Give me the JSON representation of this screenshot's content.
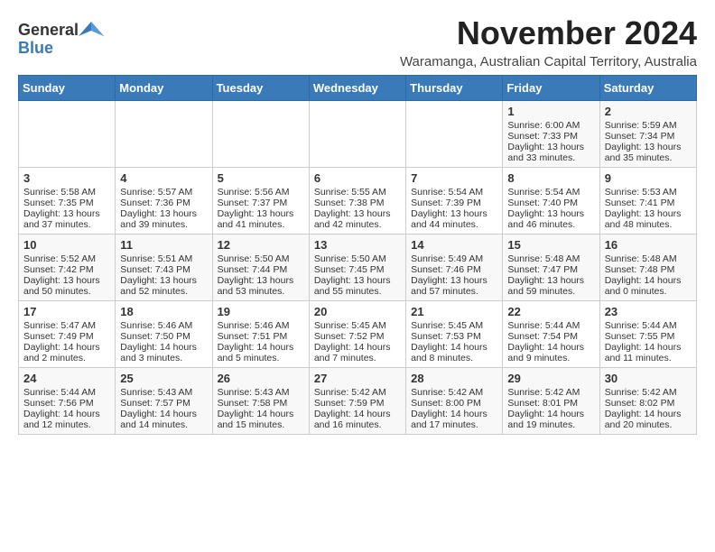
{
  "logo": {
    "general": "General",
    "blue": "Blue"
  },
  "title": "November 2024",
  "subtitle": "Waramanga, Australian Capital Territory, Australia",
  "headers": [
    "Sunday",
    "Monday",
    "Tuesday",
    "Wednesday",
    "Thursday",
    "Friday",
    "Saturday"
  ],
  "weeks": [
    [
      {
        "day": "",
        "lines": []
      },
      {
        "day": "",
        "lines": []
      },
      {
        "day": "",
        "lines": []
      },
      {
        "day": "",
        "lines": []
      },
      {
        "day": "",
        "lines": []
      },
      {
        "day": "1",
        "lines": [
          "Sunrise: 6:00 AM",
          "Sunset: 7:33 PM",
          "Daylight: 13 hours",
          "and 33 minutes."
        ]
      },
      {
        "day": "2",
        "lines": [
          "Sunrise: 5:59 AM",
          "Sunset: 7:34 PM",
          "Daylight: 13 hours",
          "and 35 minutes."
        ]
      }
    ],
    [
      {
        "day": "3",
        "lines": [
          "Sunrise: 5:58 AM",
          "Sunset: 7:35 PM",
          "Daylight: 13 hours",
          "and 37 minutes."
        ]
      },
      {
        "day": "4",
        "lines": [
          "Sunrise: 5:57 AM",
          "Sunset: 7:36 PM",
          "Daylight: 13 hours",
          "and 39 minutes."
        ]
      },
      {
        "day": "5",
        "lines": [
          "Sunrise: 5:56 AM",
          "Sunset: 7:37 PM",
          "Daylight: 13 hours",
          "and 41 minutes."
        ]
      },
      {
        "day": "6",
        "lines": [
          "Sunrise: 5:55 AM",
          "Sunset: 7:38 PM",
          "Daylight: 13 hours",
          "and 42 minutes."
        ]
      },
      {
        "day": "7",
        "lines": [
          "Sunrise: 5:54 AM",
          "Sunset: 7:39 PM",
          "Daylight: 13 hours",
          "and 44 minutes."
        ]
      },
      {
        "day": "8",
        "lines": [
          "Sunrise: 5:54 AM",
          "Sunset: 7:40 PM",
          "Daylight: 13 hours",
          "and 46 minutes."
        ]
      },
      {
        "day": "9",
        "lines": [
          "Sunrise: 5:53 AM",
          "Sunset: 7:41 PM",
          "Daylight: 13 hours",
          "and 48 minutes."
        ]
      }
    ],
    [
      {
        "day": "10",
        "lines": [
          "Sunrise: 5:52 AM",
          "Sunset: 7:42 PM",
          "Daylight: 13 hours",
          "and 50 minutes."
        ]
      },
      {
        "day": "11",
        "lines": [
          "Sunrise: 5:51 AM",
          "Sunset: 7:43 PM",
          "Daylight: 13 hours",
          "and 52 minutes."
        ]
      },
      {
        "day": "12",
        "lines": [
          "Sunrise: 5:50 AM",
          "Sunset: 7:44 PM",
          "Daylight: 13 hours",
          "and 53 minutes."
        ]
      },
      {
        "day": "13",
        "lines": [
          "Sunrise: 5:50 AM",
          "Sunset: 7:45 PM",
          "Daylight: 13 hours",
          "and 55 minutes."
        ]
      },
      {
        "day": "14",
        "lines": [
          "Sunrise: 5:49 AM",
          "Sunset: 7:46 PM",
          "Daylight: 13 hours",
          "and 57 minutes."
        ]
      },
      {
        "day": "15",
        "lines": [
          "Sunrise: 5:48 AM",
          "Sunset: 7:47 PM",
          "Daylight: 13 hours",
          "and 59 minutes."
        ]
      },
      {
        "day": "16",
        "lines": [
          "Sunrise: 5:48 AM",
          "Sunset: 7:48 PM",
          "Daylight: 14 hours",
          "and 0 minutes."
        ]
      }
    ],
    [
      {
        "day": "17",
        "lines": [
          "Sunrise: 5:47 AM",
          "Sunset: 7:49 PM",
          "Daylight: 14 hours",
          "and 2 minutes."
        ]
      },
      {
        "day": "18",
        "lines": [
          "Sunrise: 5:46 AM",
          "Sunset: 7:50 PM",
          "Daylight: 14 hours",
          "and 3 minutes."
        ]
      },
      {
        "day": "19",
        "lines": [
          "Sunrise: 5:46 AM",
          "Sunset: 7:51 PM",
          "Daylight: 14 hours",
          "and 5 minutes."
        ]
      },
      {
        "day": "20",
        "lines": [
          "Sunrise: 5:45 AM",
          "Sunset: 7:52 PM",
          "Daylight: 14 hours",
          "and 7 minutes."
        ]
      },
      {
        "day": "21",
        "lines": [
          "Sunrise: 5:45 AM",
          "Sunset: 7:53 PM",
          "Daylight: 14 hours",
          "and 8 minutes."
        ]
      },
      {
        "day": "22",
        "lines": [
          "Sunrise: 5:44 AM",
          "Sunset: 7:54 PM",
          "Daylight: 14 hours",
          "and 9 minutes."
        ]
      },
      {
        "day": "23",
        "lines": [
          "Sunrise: 5:44 AM",
          "Sunset: 7:55 PM",
          "Daylight: 14 hours",
          "and 11 minutes."
        ]
      }
    ],
    [
      {
        "day": "24",
        "lines": [
          "Sunrise: 5:44 AM",
          "Sunset: 7:56 PM",
          "Daylight: 14 hours",
          "and 12 minutes."
        ]
      },
      {
        "day": "25",
        "lines": [
          "Sunrise: 5:43 AM",
          "Sunset: 7:57 PM",
          "Daylight: 14 hours",
          "and 14 minutes."
        ]
      },
      {
        "day": "26",
        "lines": [
          "Sunrise: 5:43 AM",
          "Sunset: 7:58 PM",
          "Daylight: 14 hours",
          "and 15 minutes."
        ]
      },
      {
        "day": "27",
        "lines": [
          "Sunrise: 5:42 AM",
          "Sunset: 7:59 PM",
          "Daylight: 14 hours",
          "and 16 minutes."
        ]
      },
      {
        "day": "28",
        "lines": [
          "Sunrise: 5:42 AM",
          "Sunset: 8:00 PM",
          "Daylight: 14 hours",
          "and 17 minutes."
        ]
      },
      {
        "day": "29",
        "lines": [
          "Sunrise: 5:42 AM",
          "Sunset: 8:01 PM",
          "Daylight: 14 hours",
          "and 19 minutes."
        ]
      },
      {
        "day": "30",
        "lines": [
          "Sunrise: 5:42 AM",
          "Sunset: 8:02 PM",
          "Daylight: 14 hours",
          "and 20 minutes."
        ]
      }
    ]
  ]
}
